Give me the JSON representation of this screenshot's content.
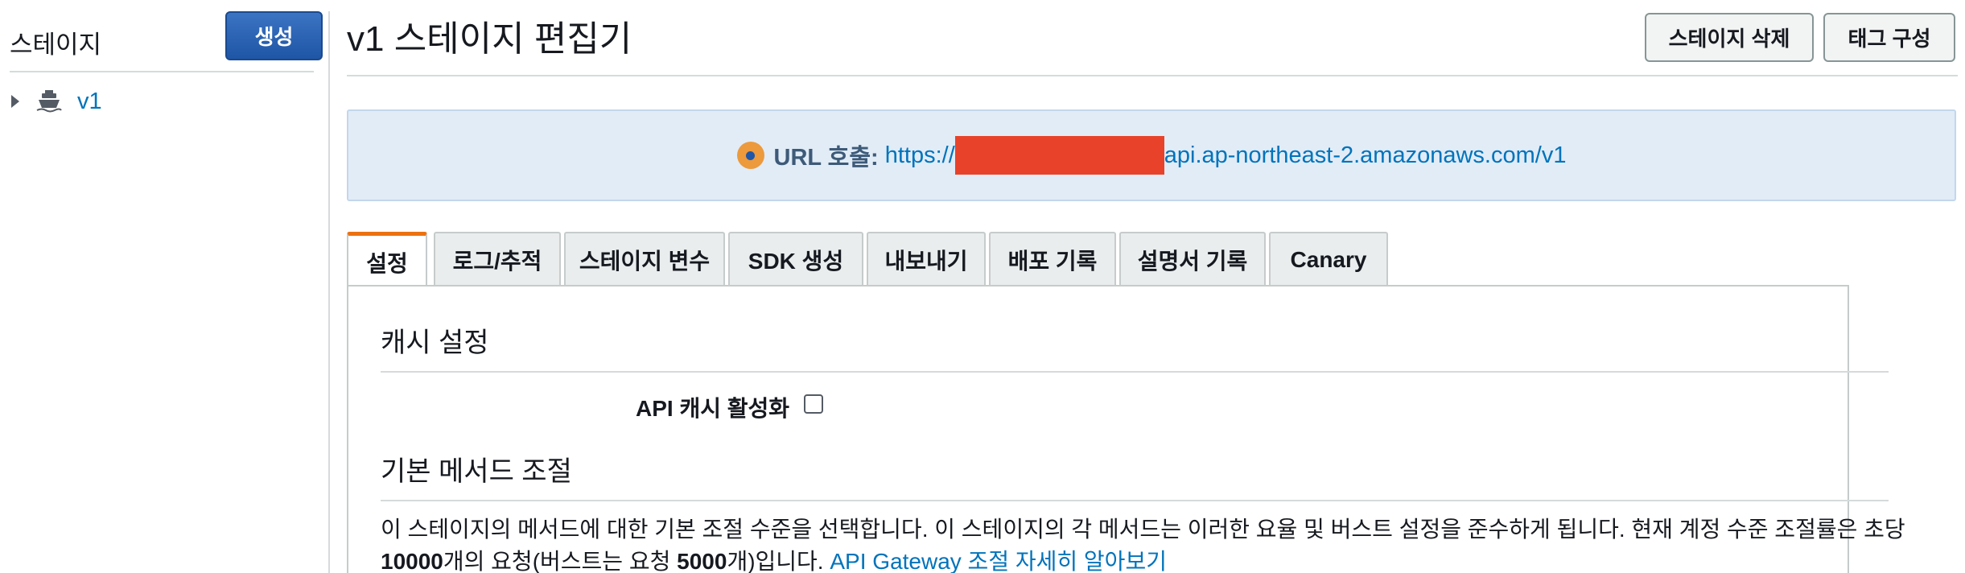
{
  "sidebar": {
    "title": "스테이지",
    "create_label": "생성",
    "items": [
      {
        "label": "v1",
        "icon": "stage-icon"
      }
    ]
  },
  "header": {
    "title": "v1 스테이지 편집기",
    "delete_label": "스테이지 삭제",
    "tag_label": "태그 구성"
  },
  "url_banner": {
    "label": "URL 호출:",
    "url_prefix": "https://",
    "url_suffix": "api.ap-northeast-2.amazonaws.com/v1",
    "icon": "info-icon",
    "icon_color": "#ec9a3c"
  },
  "tabs": [
    {
      "label": "설정",
      "active": true
    },
    {
      "label": "로그/추적"
    },
    {
      "label": "스테이지 변수"
    },
    {
      "label": "SDK 생성"
    },
    {
      "label": "내보내기"
    },
    {
      "label": "배포 기록"
    },
    {
      "label": "설명서 기록"
    },
    {
      "label": "Canary"
    }
  ],
  "cache_settings": {
    "title": "캐시 설정",
    "enable_label": "API 캐시 활성화",
    "enabled": false
  },
  "throttling": {
    "title": "기본 메서드 조절",
    "desc_1": "이 스테이지의 메서드에 대한 기본 조절 수준을 선택합니다. 이 스테이지의 각 메서드는 이러한 요율 및 버스트 설정을 준수하게 됩니다. 현재 계정 수준 조절률은 초당 ",
    "rate": "10000",
    "desc_2": "개의 요청(버스트는 요청 ",
    "burst": "5000",
    "desc_3": "개)입니다. ",
    "link": "API Gateway 조절 자세히 알아보기"
  },
  "colors": {
    "accent": "#ec7211",
    "primary_button": "#1f56a6",
    "link": "#0073bb",
    "banner_bg": "#e1ecf7"
  }
}
